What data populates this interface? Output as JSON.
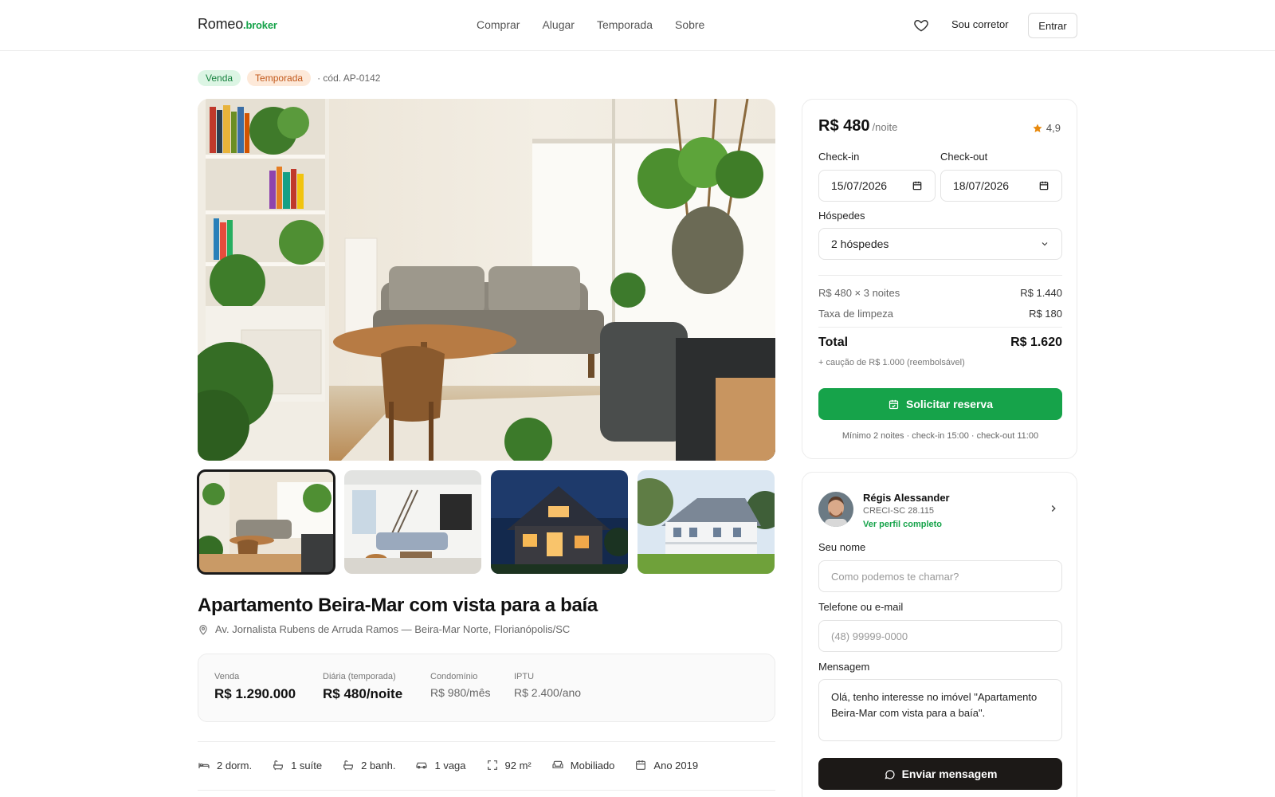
{
  "header": {
    "logo_main": "Romeo",
    "logo_suffix": ".broker",
    "nav": [
      "Comprar",
      "Alugar",
      "Temporada",
      "Sobre"
    ],
    "favorites_icon": "heart-icon",
    "sou_corretor": "Sou corretor",
    "entrar": "Entrar"
  },
  "tags": {
    "venda": "Venda",
    "temporada": "Temporada",
    "code": "· cód. AP-0142"
  },
  "gallery": {
    "thumbnails": [
      "Sala de estar",
      "Sala com escada",
      "Casa à noite",
      "Casa com varanda"
    ]
  },
  "listing": {
    "title": "Apartamento Beira-Mar com vista para a baía",
    "address": "Av. Jornalista Rubens de Arruda Ramos — Beira-Mar Norte, Florianópolis/SC",
    "prices": [
      {
        "label": "Venda",
        "value": "R$ 1.290.000"
      },
      {
        "label": "Diária (temporada)",
        "value": "R$ 480/noite"
      },
      {
        "label": "Condomínio",
        "value": "R$ 980/mês"
      },
      {
        "label": "IPTU",
        "value": "R$ 2.400/ano"
      }
    ],
    "features": [
      {
        "icon": "bed-icon",
        "label": "2 dorm."
      },
      {
        "icon": "bathtub-icon",
        "label": "1 suíte"
      },
      {
        "icon": "bathtub-icon",
        "label": "2 banh."
      },
      {
        "icon": "car-icon",
        "label": "1 vaga"
      },
      {
        "icon": "area-icon",
        "label": "92 m²"
      },
      {
        "icon": "sofa-icon",
        "label": "Mobiliado"
      },
      {
        "icon": "calendar-icon",
        "label": "Ano 2019"
      }
    ]
  },
  "booking": {
    "price": "R$ 480",
    "per": "/noite",
    "rating": "4,9",
    "checkin_label": "Check-in",
    "checkin_value": "15/07/2026",
    "checkout_label": "Check-out",
    "checkout_value": "18/07/2026",
    "guests_label": "Hóspedes",
    "guests_value": "2 hóspedes",
    "line1_label": "R$ 480 × 3 noites",
    "line1_value": "R$ 1.440",
    "line2_label": "Taxa de limpeza",
    "line2_value": "R$ 180",
    "total_label": "Total",
    "total_value": "R$ 1.620",
    "caucao": "+ caução de R$ 1.000 (reembolsável)",
    "button": "Solicitar reserva",
    "note": "Mínimo 2 noites · check-in 15:00 · check-out 11:00"
  },
  "contact": {
    "agent_name": "Régis Alessander",
    "creci": "CRECI-SC 28.115",
    "profile_link": "Ver perfil completo",
    "name_label": "Seu nome",
    "name_placeholder": "Como podemos te chamar?",
    "phone_label": "Telefone ou e-mail",
    "phone_placeholder": "(48) 99999-0000",
    "message_label": "Mensagem",
    "message_value": "Olá, tenho interesse no imóvel \"Apartamento Beira-Mar com vista para a baía\".",
    "button": "Enviar mensagem"
  },
  "colors": {
    "accent": "#16a34a",
    "dark": "#1c1917",
    "star": "#e8890c"
  }
}
